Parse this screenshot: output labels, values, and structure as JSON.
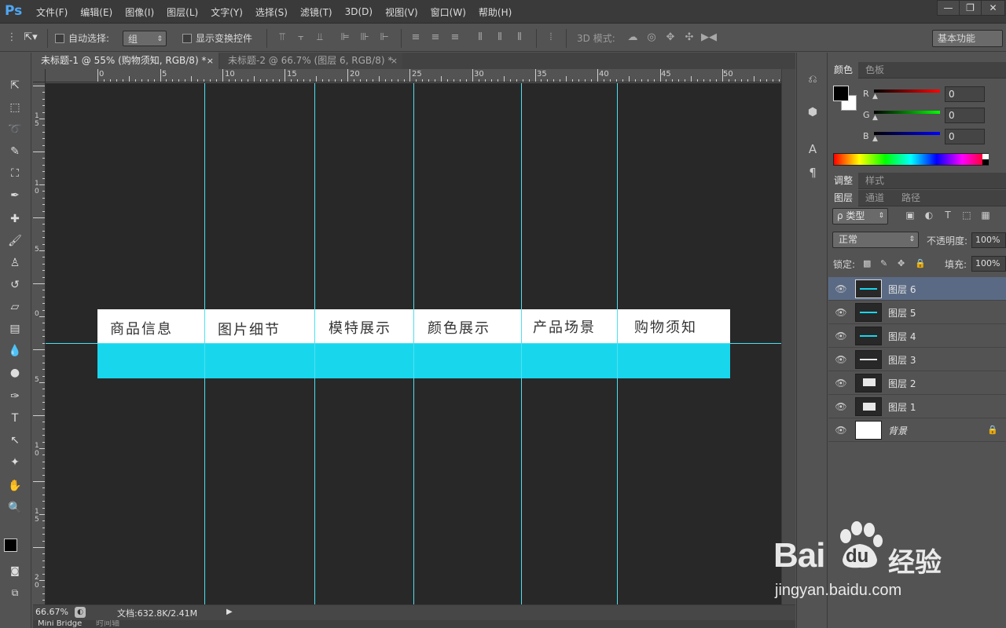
{
  "app": {
    "logo": "Ps"
  },
  "menu": [
    "文件(F)",
    "编辑(E)",
    "图像(I)",
    "图层(L)",
    "文字(Y)",
    "选择(S)",
    "滤镜(T)",
    "3D(D)",
    "视图(V)",
    "窗口(W)",
    "帮助(H)"
  ],
  "window_controls": {
    "minimize": "—",
    "restore": "❐",
    "close": "✕"
  },
  "options": {
    "auto_select_label": "自动选择:",
    "auto_select_value": "组",
    "show_transform_label": "显示变换控件",
    "mode_3d_label": "3D 模式:",
    "workspace": "基本功能"
  },
  "doc_tabs": [
    {
      "label": "未标题-1 @ 55% (购物须知, RGB/8) *",
      "close": "×",
      "active": true
    },
    {
      "label": "未标题-2 @ 66.7% (图层 6, RGB/8) *",
      "close": "×",
      "active": false
    }
  ],
  "ruler_h": [
    "0",
    "5",
    "10",
    "15",
    "20",
    "25",
    "30",
    "35",
    "40",
    "45",
    "50"
  ],
  "ruler_v": [
    "1\n5",
    "1\n0",
    "5",
    "0",
    "5",
    "1\n0",
    "1\n5",
    "2\n0"
  ],
  "canvas": {
    "nav_items": [
      "商品信息",
      "图片细节",
      "模特展示",
      "颜色展示",
      "产品场景",
      "购物须知"
    ],
    "colors": {
      "background": "#282828",
      "bar_top": "#ffffff",
      "bar_bottom": "#18d7ed",
      "guide": "#4ee0f0"
    }
  },
  "status": {
    "zoom": "66.67%",
    "doc_info": "文档:632.8K/2.41M"
  },
  "bottom_tabs": [
    "Mini Bridge",
    "时间轴"
  ],
  "color_panel": {
    "tabs": [
      "颜色",
      "色板"
    ],
    "channels": [
      {
        "label": "R",
        "value": "0"
      },
      {
        "label": "G",
        "value": "0"
      },
      {
        "label": "B",
        "value": "0"
      }
    ]
  },
  "adjust_tabs": [
    "调整",
    "样式"
  ],
  "layers_panel": {
    "tabs": [
      "图层",
      "通道",
      "路径"
    ],
    "filter_label": "ρ 类型",
    "blend_mode": "正常",
    "opacity_label": "不透明度:",
    "opacity_value": "100%",
    "lock_label": "锁定:",
    "fill_label": "填充:",
    "fill_value": "100%",
    "layers": [
      {
        "name": "图层 6",
        "selected": true
      },
      {
        "name": "图层 5",
        "selected": false
      },
      {
        "name": "图层 4",
        "selected": false
      },
      {
        "name": "图层 3",
        "selected": false
      },
      {
        "name": "图层 2",
        "selected": false
      },
      {
        "name": "图层 1",
        "selected": false
      },
      {
        "name": "背景",
        "selected": false,
        "locked": true
      }
    ]
  },
  "watermark": {
    "brand": "Bai",
    "brand2": "du",
    "cn": "经验",
    "url": "jingyan.baidu.com"
  }
}
